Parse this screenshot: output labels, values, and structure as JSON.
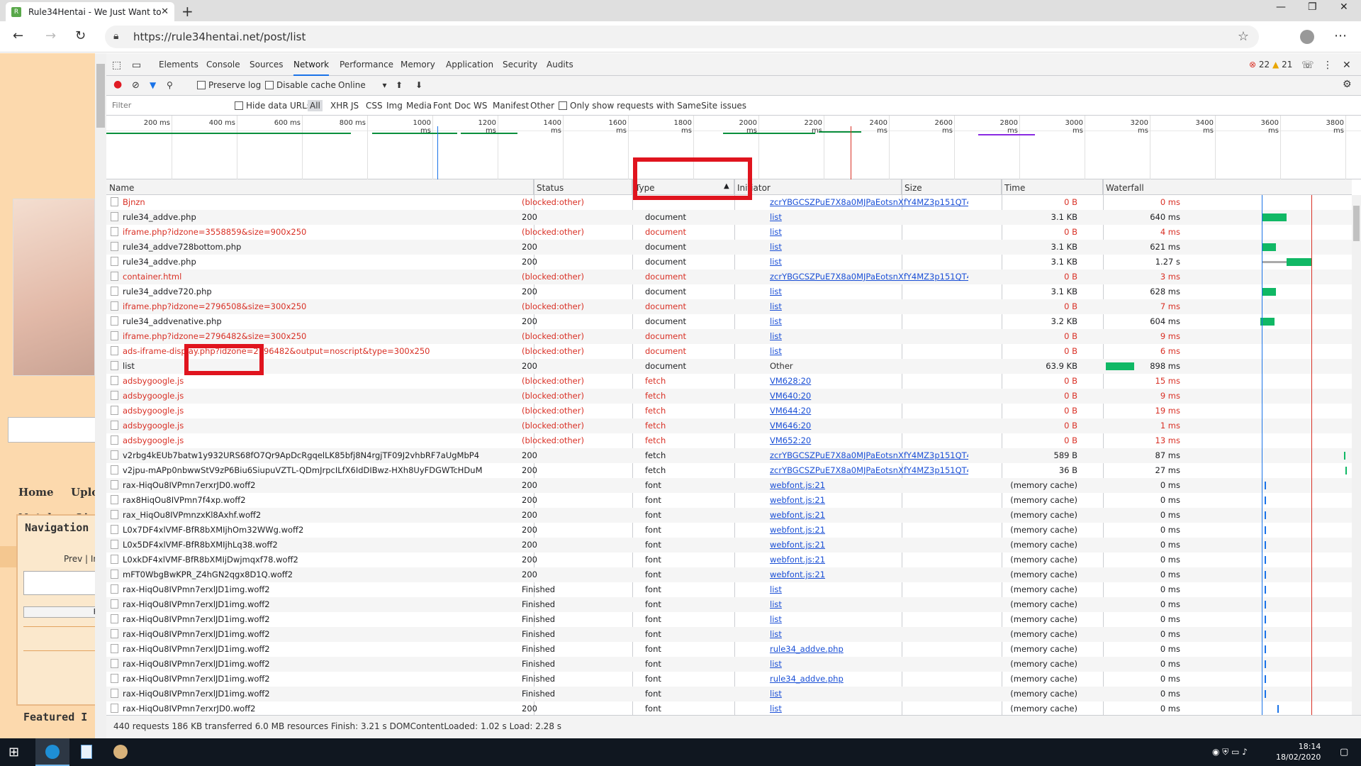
{
  "browser": {
    "tab_title": "Rule34Hentai - We Just Want to",
    "url": "https://rule34hentai.net/post/list"
  },
  "page": {
    "links": [
      "Home",
      "Uplo",
      "Nutaku",
      "Live"
    ],
    "navigation_title": "Navigation",
    "prev_text": "Prev | In",
    "nav_button": "F",
    "featured_title": "Featured I"
  },
  "devtools": {
    "tabs": [
      "Elements",
      "Console",
      "Sources",
      "Network",
      "Performance",
      "Memory",
      "Application",
      "Security",
      "Audits"
    ],
    "selected_tab": "Network",
    "errors": "22",
    "warnings": "21",
    "toolbar": {
      "preserve_log": "Preserve log",
      "disable_cache": "Disable cache",
      "throttle": "Online"
    },
    "filter": {
      "placeholder": "Filter",
      "hide_data_urls": "Hide data URLs",
      "types": [
        "All",
        "XHR",
        "JS",
        "CSS",
        "Img",
        "Media",
        "Font",
        "Doc",
        "WS",
        "Manifest",
        "Other"
      ],
      "samesite": "Only show requests with SameSite issues"
    },
    "overview_ticks": [
      "200 ms",
      "400 ms",
      "600 ms",
      "800 ms",
      "1000 ms",
      "1200 ms",
      "1400 ms",
      "1600 ms",
      "1800 ms",
      "2000 ms",
      "2200 ms",
      "2400 ms",
      "2600 ms",
      "2800 ms",
      "3000 ms",
      "3200 ms",
      "3400 ms",
      "3600 ms",
      "3800 ms"
    ],
    "columns": {
      "name": "Name",
      "status": "Status",
      "type": "Type",
      "initiator": "Initiator",
      "size": "Size",
      "time": "Time",
      "waterfall": "Waterfall"
    },
    "rows": [
      {
        "name": "Bjnzn",
        "status": "(blocked:other)",
        "type": "",
        "initiator": "zcrYBGCSZPuE7X8a0MJPaEotsnXfY4MZ3p151QT4g...",
        "size": "0 B",
        "time": "0 ms",
        "red": true
      },
      {
        "name": "rule34_addve.php",
        "status": "200",
        "type": "document",
        "initiator": "list",
        "size": "3.1 KB",
        "time": "640 ms",
        "red": false
      },
      {
        "name": "iframe.php?idzone=3558859&size=900x250",
        "status": "(blocked:other)",
        "type": "document",
        "initiator": "list",
        "size": "0 B",
        "time": "4 ms",
        "red": true
      },
      {
        "name": "rule34_addve728bottom.php",
        "status": "200",
        "type": "document",
        "initiator": "list",
        "size": "3.1 KB",
        "time": "621 ms",
        "red": false
      },
      {
        "name": "rule34_addve.php",
        "status": "200",
        "type": "document",
        "initiator": "list",
        "size": "3.1 KB",
        "time": "1.27 s",
        "red": false
      },
      {
        "name": "container.html",
        "status": "(blocked:other)",
        "type": "document",
        "initiator": "zcrYBGCSZPuE7X8a0MJPaEotsnXfY4MZ3p151QT4g...",
        "size": "0 B",
        "time": "3 ms",
        "red": true
      },
      {
        "name": "rule34_addve720.php",
        "status": "200",
        "type": "document",
        "initiator": "list",
        "size": "3.1 KB",
        "time": "628 ms",
        "red": false
      },
      {
        "name": "iframe.php?idzone=2796508&size=300x250",
        "status": "(blocked:other)",
        "type": "document",
        "initiator": "list",
        "size": "0 B",
        "time": "7 ms",
        "red": true
      },
      {
        "name": "rule34_addvenative.php",
        "status": "200",
        "type": "document",
        "initiator": "list",
        "size": "3.2 KB",
        "time": "604 ms",
        "red": false
      },
      {
        "name": "iframe.php?idzone=2796482&size=300x250",
        "status": "(blocked:other)",
        "type": "document",
        "initiator": "list",
        "size": "0 B",
        "time": "9 ms",
        "red": true
      },
      {
        "name": "ads-iframe-display.php?idzone=2796482&output=noscript&type=300x250",
        "status": "(blocked:other)",
        "type": "document",
        "initiator": "list",
        "size": "0 B",
        "time": "6 ms",
        "red": true
      },
      {
        "name": "list",
        "status": "200",
        "type": "document",
        "initiator": "Other",
        "size": "63.9 KB",
        "time": "898 ms",
        "red": false,
        "plain": true
      },
      {
        "name": "adsbygoogle.js",
        "status": "(blocked:other)",
        "type": "fetch",
        "initiator": "VM628:20",
        "size": "0 B",
        "time": "15 ms",
        "red": true
      },
      {
        "name": "adsbygoogle.js",
        "status": "(blocked:other)",
        "type": "fetch",
        "initiator": "VM640:20",
        "size": "0 B",
        "time": "9 ms",
        "red": true
      },
      {
        "name": "adsbygoogle.js",
        "status": "(blocked:other)",
        "type": "fetch",
        "initiator": "VM644:20",
        "size": "0 B",
        "time": "19 ms",
        "red": true
      },
      {
        "name": "adsbygoogle.js",
        "status": "(blocked:other)",
        "type": "fetch",
        "initiator": "VM646:20",
        "size": "0 B",
        "time": "1 ms",
        "red": true
      },
      {
        "name": "adsbygoogle.js",
        "status": "(blocked:other)",
        "type": "fetch",
        "initiator": "VM652:20",
        "size": "0 B",
        "time": "13 ms",
        "red": true
      },
      {
        "name": "v2rbg4kEUb7batw1y932URS68fO7Qr9ApDcRgqelLK85bfj8N4rgjTF09J2vhbRF7aUgMbP4",
        "status": "200",
        "type": "fetch",
        "initiator": "zcrYBGCSZPuE7X8a0MJPaEotsnXfY4MZ3p151QT4g...",
        "size": "589 B",
        "time": "87 ms",
        "red": false
      },
      {
        "name": "v2jpu-mAPp0nbwwStV9zP6Biu6SiupuVZTL-QDmJrpcILfX6IdDIBwz-HXh8UyFDGWTcHDuM",
        "status": "200",
        "type": "fetch",
        "initiator": "zcrYBGCSZPuE7X8a0MJPaEotsnXfY4MZ3p151QT4g...",
        "size": "36 B",
        "time": "27 ms",
        "red": false
      },
      {
        "name": "rax-HiqOu8IVPmn7erxrJD0.woff2",
        "status": "200",
        "type": "font",
        "initiator": "webfont.js:21",
        "size": "(memory cache)",
        "time": "0 ms",
        "red": false
      },
      {
        "name": "rax8HiqOu8IVPmn7f4xp.woff2",
        "status": "200",
        "type": "font",
        "initiator": "webfont.js:21",
        "size": "(memory cache)",
        "time": "0 ms",
        "red": false
      },
      {
        "name": "rax_HiqOu8IVPmnzxKl8Axhf.woff2",
        "status": "200",
        "type": "font",
        "initiator": "webfont.js:21",
        "size": "(memory cache)",
        "time": "0 ms",
        "red": false
      },
      {
        "name": "L0x7DF4xlVMF-BfR8bXMIjhOm32WWg.woff2",
        "status": "200",
        "type": "font",
        "initiator": "webfont.js:21",
        "size": "(memory cache)",
        "time": "0 ms",
        "red": false
      },
      {
        "name": "L0x5DF4xlVMF-BfR8bXMIjhLq38.woff2",
        "status": "200",
        "type": "font",
        "initiator": "webfont.js:21",
        "size": "(memory cache)",
        "time": "0 ms",
        "red": false
      },
      {
        "name": "L0xkDF4xlVMF-BfR8bXMIjDwjmqxf78.woff2",
        "status": "200",
        "type": "font",
        "initiator": "webfont.js:21",
        "size": "(memory cache)",
        "time": "0 ms",
        "red": false
      },
      {
        "name": "mFT0WbgBwKPR_Z4hGN2qgx8D1Q.woff2",
        "status": "200",
        "type": "font",
        "initiator": "webfont.js:21",
        "size": "(memory cache)",
        "time": "0 ms",
        "red": false
      },
      {
        "name": "rax-HiqOu8IVPmn7erxlJD1img.woff2",
        "status": "Finished",
        "type": "font",
        "initiator": "list",
        "size": "(memory cache)",
        "time": "0 ms",
        "red": false
      },
      {
        "name": "rax-HiqOu8IVPmn7erxlJD1img.woff2",
        "status": "Finished",
        "type": "font",
        "initiator": "list",
        "size": "(memory cache)",
        "time": "0 ms",
        "red": false
      },
      {
        "name": "rax-HiqOu8IVPmn7erxlJD1img.woff2",
        "status": "Finished",
        "type": "font",
        "initiator": "list",
        "size": "(memory cache)",
        "time": "0 ms",
        "red": false
      },
      {
        "name": "rax-HiqOu8IVPmn7erxlJD1img.woff2",
        "status": "Finished",
        "type": "font",
        "initiator": "list",
        "size": "(memory cache)",
        "time": "0 ms",
        "red": false
      },
      {
        "name": "rax-HiqOu8IVPmn7erxlJD1img.woff2",
        "status": "Finished",
        "type": "font",
        "initiator": "rule34_addve.php",
        "size": "(memory cache)",
        "time": "0 ms",
        "red": false
      },
      {
        "name": "rax-HiqOu8IVPmn7erxlJD1img.woff2",
        "status": "Finished",
        "type": "font",
        "initiator": "list",
        "size": "(memory cache)",
        "time": "0 ms",
        "red": false
      },
      {
        "name": "rax-HiqOu8IVPmn7erxlJD1img.woff2",
        "status": "Finished",
        "type": "font",
        "initiator": "rule34_addve.php",
        "size": "(memory cache)",
        "time": "0 ms",
        "red": false
      },
      {
        "name": "rax-HiqOu8IVPmn7erxlJD1img.woff2",
        "status": "Finished",
        "type": "font",
        "initiator": "list",
        "size": "(memory cache)",
        "time": "0 ms",
        "red": false
      },
      {
        "name": "rax-HiqOu8IVPmn7erxrJD0.woff2",
        "status": "200",
        "type": "font",
        "initiator": "list",
        "size": "(memory cache)",
        "time": "0 ms",
        "red": false
      }
    ],
    "status_bar": "440 requests   186 KB transferred   6.0 MB resources   Finish: 3.21 s   DOMContentLoaded: 1.02 s   Load: 2.28 s"
  },
  "taskbar": {
    "time": "18:14",
    "date": "18/02/2020"
  },
  "colors": {
    "error_red": "#d93025",
    "highlight_red": "#e0141e",
    "waterfall_green": "#10b865",
    "link_blue": "#1a4fd6"
  }
}
